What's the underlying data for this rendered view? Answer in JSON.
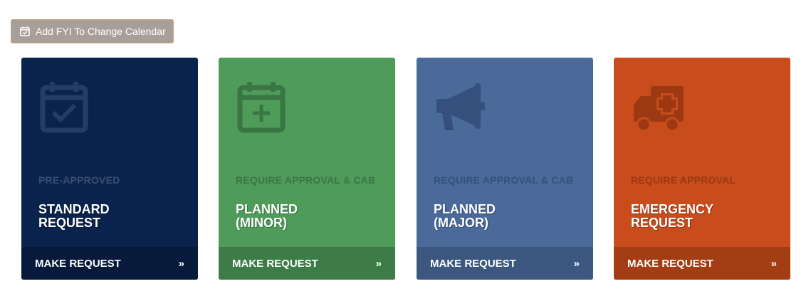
{
  "fyi_button": {
    "label": "Add FYI To Change Calendar",
    "icon": "calendar-check-icon"
  },
  "cards": [
    {
      "category": "PRE-APPROVED",
      "title": "STANDARD\nREQUEST",
      "action": "MAKE REQUEST",
      "icon": "calendar-check-icon",
      "color": "#0a234c"
    },
    {
      "category": "REQUIRE APPROVAL & CAB",
      "title": "PLANNED\n(MINOR)",
      "action": "MAKE REQUEST",
      "icon": "calendar-plus-icon",
      "color": "#4f9c5a"
    },
    {
      "category": "REQUIRE APPROVAL & CAB",
      "title": "PLANNED\n(MAJOR)",
      "action": "MAKE REQUEST",
      "icon": "megaphone-icon",
      "color": "#4a6a9a"
    },
    {
      "category": "REQUIRE APPROVAL",
      "title": "EMERGENCY\nREQUEST",
      "action": "MAKE REQUEST",
      "icon": "ambulance-icon",
      "color": "#c84c1c"
    }
  ]
}
